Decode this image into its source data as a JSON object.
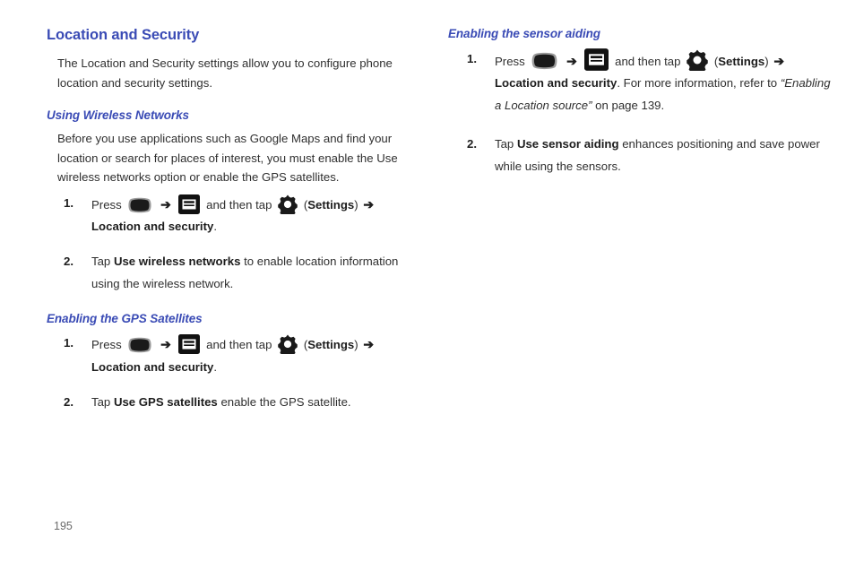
{
  "page": {
    "number": "195",
    "background": "#ffffff",
    "heading_color": "#3a4bb5",
    "body_color": "#2f2f2f"
  },
  "left_column": {
    "section_title": "Location and Security",
    "intro_paragraph": "The Location and Security settings allow you to configure phone location and security settings.",
    "subsections": [
      {
        "title": "Using Wireless Networks",
        "paragraph": "Before you use applications such as Google Maps and find your location or search for places of interest, you must enable the Use wireless networks option or enable the GPS satellites.",
        "steps": [
          {
            "number": "1.",
            "press_label": "Press",
            "icon_home": "home-key-icon",
            "arrow": "➔",
            "icon_menu": "menu-key-icon",
            "mid_text": "and then tap",
            "icon_gear": "settings-gear-icon",
            "settings_open": "(",
            "settings_label": "Settings",
            "settings_close": ")",
            "arrow2": "➔",
            "target_bold": "Location and security",
            "trailing": "."
          },
          {
            "number": "2.",
            "lead": "Tap",
            "bold_term": "Use wireless networks",
            "rest": "to enable location information using the wireless network."
          }
        ]
      },
      {
        "title": "Enabling the GPS Satellites",
        "steps": [
          {
            "number": "1.",
            "press_label": "Press",
            "icon_home": "home-key-icon",
            "arrow": "➔",
            "icon_menu": "menu-key-icon",
            "mid_text": "and then tap",
            "icon_gear": "settings-gear-icon",
            "settings_open": "(",
            "settings_label": "Settings",
            "settings_close": ")",
            "arrow2": "➔",
            "target_bold": "Location and security",
            "trailing": "."
          },
          {
            "number": "2.",
            "lead": "Tap",
            "bold_term": "Use GPS satellites",
            "rest": "enable the GPS satellite."
          }
        ]
      }
    ]
  },
  "right_column": {
    "subsections": [
      {
        "title": "Enabling the sensor aiding",
        "steps": [
          {
            "number": "1.",
            "press_label": "Press",
            "icon_home": "home-key-icon",
            "arrow": "➔",
            "icon_menu": "menu-key-icon",
            "mid_text": "and then tap",
            "icon_gear": "settings-gear-icon",
            "settings_open": "(",
            "settings_label": "Settings",
            "settings_close": ")",
            "arrow2": "➔",
            "target_bold": "Location and security",
            "after_target": ". For more information, refer to",
            "cross_ref": "“Enabling a Location source”",
            "page_ref": "on page 139."
          },
          {
            "number": "2.",
            "lead": "Tap",
            "bold_term": "Use sensor aiding",
            "rest": "enhances positioning and save power while using the sensors."
          }
        ]
      }
    ]
  }
}
